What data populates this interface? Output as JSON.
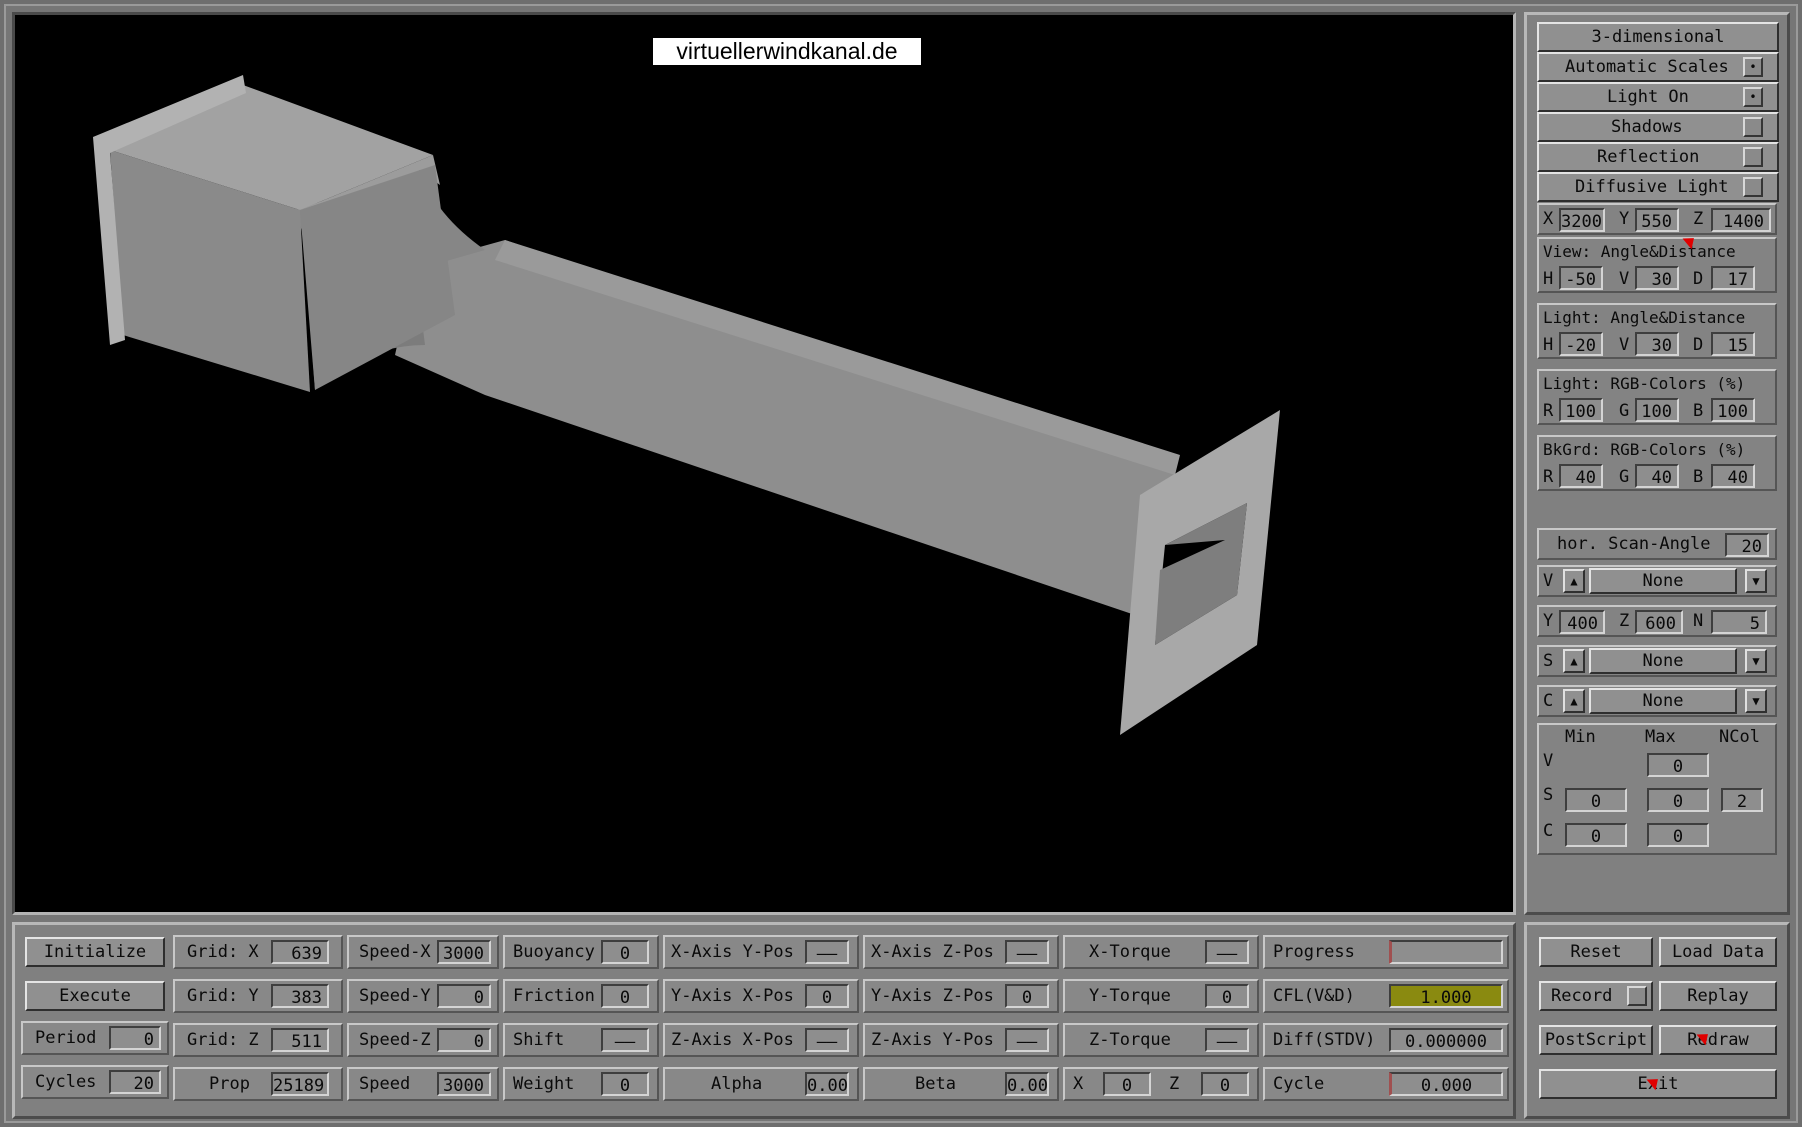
{
  "watermark": "virtuellerwindkanal.de",
  "side": {
    "mode_button": "3-dimensional",
    "toggles": [
      {
        "label": "Automatic Scales",
        "mark": "•"
      },
      {
        "label": "Light On",
        "mark": "•"
      },
      {
        "label": "Shadows",
        "mark": ""
      },
      {
        "label": "Reflection",
        "mark": ""
      },
      {
        "label": "Diffusive Light",
        "mark": ""
      }
    ],
    "pos": {
      "x_label": "X",
      "x": "3200",
      "y_label": "Y",
      "y": "550",
      "z_label": "Z",
      "z": "1400"
    },
    "view": {
      "title": "View:  Angle&Distance",
      "h_label": "H",
      "h": "-50",
      "v_label": "V",
      "v": "30",
      "d_label": "D",
      "d": "17"
    },
    "light_angle": {
      "title": "Light: Angle&Distance",
      "h_label": "H",
      "h": "-20",
      "v_label": "V",
      "v": "30",
      "d_label": "D",
      "d": "15"
    },
    "light_rgb": {
      "title": "Light: RGB-Colors (%)",
      "r_label": "R",
      "r": "100",
      "g_label": "G",
      "g": "100",
      "b_label": "B",
      "b": "100"
    },
    "bkgrd_rgb": {
      "title": "BkGrd: RGB-Colors (%)",
      "r_label": "R",
      "r": "40",
      "g_label": "G",
      "g": "40",
      "b_label": "B",
      "b": "40"
    },
    "scan": {
      "label": "hor. Scan-Angle",
      "value": "20"
    },
    "v_select": {
      "label": "V",
      "value": "None"
    },
    "yzn": {
      "y_label": "Y",
      "y": "400",
      "z_label": "Z",
      "z": "600",
      "n_label": "N",
      "n": "5"
    },
    "s_select": {
      "label": "S",
      "value": "None"
    },
    "c_select": {
      "label": "C",
      "value": "None"
    },
    "scale": {
      "min_header": "Min",
      "max_header": "Max",
      "ncol_header": "NCol",
      "v_label": "V",
      "v_max": "0",
      "s_label": "S",
      "s_min": "0",
      "s_max": "0",
      "s_ncol": "2",
      "c_label": "C",
      "c_min": "0",
      "c_max": "0"
    }
  },
  "bottom": {
    "initialize": "Initialize",
    "execute": "Execute",
    "period": {
      "label": "Period",
      "value": "0"
    },
    "cycles": {
      "label": "Cycles",
      "value": "20"
    },
    "grid_x": {
      "label": "Grid: X",
      "value": "639"
    },
    "grid_y": {
      "label": "Grid: Y",
      "value": "383"
    },
    "grid_z": {
      "label": "Grid: Z",
      "value": "511"
    },
    "prop": {
      "label": "Prop",
      "value": "25189"
    },
    "speed_x": {
      "label": "Speed-X",
      "value": "3000"
    },
    "speed_y": {
      "label": "Speed-Y",
      "value": "0"
    },
    "speed_z": {
      "label": "Speed-Z",
      "value": "0"
    },
    "speed": {
      "label": "Speed",
      "value": "3000"
    },
    "buoyancy": {
      "label": "Buoyancy",
      "value": "0"
    },
    "friction": {
      "label": "Friction",
      "value": "0"
    },
    "shift": {
      "label": "Shift",
      "value": "——"
    },
    "weight": {
      "label": "Weight",
      "value": "0"
    },
    "xaxis_ypos": {
      "label": "X-Axis Y-Pos",
      "value": "——"
    },
    "yaxis_xpos": {
      "label": "Y-Axis X-Pos",
      "value": "0"
    },
    "zaxis_xpos": {
      "label": "Z-Axis X-Pos",
      "value": "——"
    },
    "alpha": {
      "label": "Alpha",
      "value": "0.00"
    },
    "xaxis_zpos": {
      "label": "X-Axis Z-Pos",
      "value": "——"
    },
    "yaxis_zpos": {
      "label": "Y-Axis Z-Pos",
      "value": "0"
    },
    "zaxis_ypos": {
      "label": "Z-Axis Y-Pos",
      "value": "——"
    },
    "beta": {
      "label": "Beta",
      "value": "0.00"
    },
    "x_torque": {
      "label": "X-Torque",
      "value": "——"
    },
    "y_torque": {
      "label": "Y-Torque",
      "value": "0"
    },
    "z_torque": {
      "label": "Z-Torque",
      "value": "——"
    },
    "x_small": {
      "label": "X",
      "value": "0"
    },
    "z_small": {
      "label": "Z",
      "value": "0"
    },
    "progress": {
      "label": "Progress",
      "value": ""
    },
    "cfl": {
      "label": "CFL(V&D)",
      "value": "1.000"
    },
    "diff": {
      "label": "Diff(STDV)",
      "value": "0.000000"
    },
    "cycle": {
      "label": "Cycle",
      "value": "0.000"
    }
  },
  "actions": {
    "reset": "Reset",
    "load": "Load Data",
    "record": "Record",
    "replay": "Replay",
    "postscript": "PostScript",
    "redraw": "Redraw",
    "exit": "Exit"
  },
  "colors": {
    "viewport_bg": "#000000",
    "panel": "#808080",
    "cfl_highlight": "#8a8a10"
  }
}
